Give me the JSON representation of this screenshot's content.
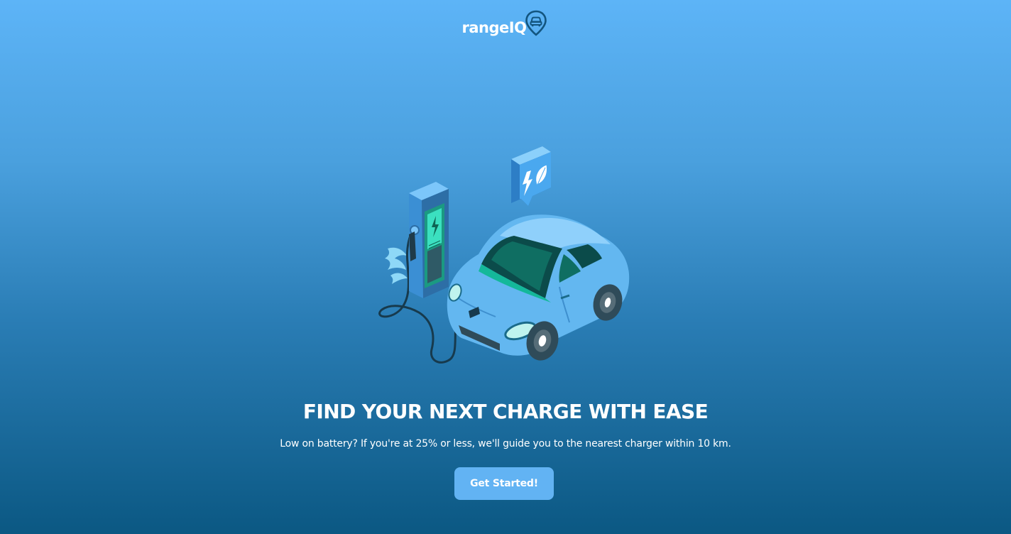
{
  "brand": {
    "name": "rangeIQ",
    "logo_icon": "map-pin-car-icon",
    "accent": "#62b3f3",
    "bg_top": "#5db4f7",
    "bg_bottom": "#0b5883"
  },
  "hero": {
    "illustration": "ev-charging-station-car-illustration",
    "bubble_icons": [
      "lightning-icon",
      "leaf-icon"
    ],
    "headline": "FIND YOUR NEXT CHARGE WITH EASE",
    "subtext": "Low on battery? If you're at 25% or less, we'll guide you to the nearest charger within 10 km.",
    "cta_label": "Get Started!"
  }
}
